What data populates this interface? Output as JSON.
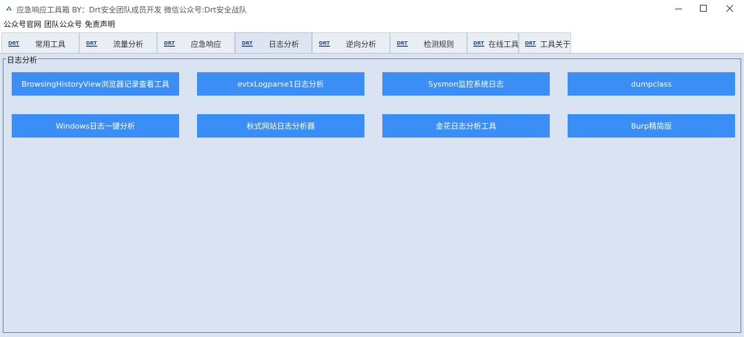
{
  "window": {
    "title": "应急响应工具箱   BY：Drt安全团队成员开发   微信公众号:Drt安全战队",
    "controls": {
      "minimize": "—",
      "maximize": "☐",
      "close": "✕"
    }
  },
  "menu": [
    "公众号官网",
    "团队公众号",
    "免责声明"
  ],
  "tabs": {
    "logo_text": "DRT",
    "items": [
      "常用工具",
      "流量分析",
      "应急响应",
      "日志分析",
      "逆向分析",
      "检测规则",
      "在线工具",
      "工具关于"
    ],
    "active_index": 3
  },
  "panel": {
    "group_title": "日志分析",
    "buttons": [
      "BrowsingHistoryView浏览器记录查看工具",
      "evtxLogparse1日志分析",
      "Sysmon监控系统日志",
      "dumpclass",
      "Windows日志一键分析",
      "秋式网站日志分析器",
      "金花日志分析工具",
      "Burp精简版"
    ]
  },
  "colors": {
    "button_bg": "#3a8ef6",
    "panel_bg": "#dae3f1",
    "tab_bg": "#e9eef5"
  }
}
